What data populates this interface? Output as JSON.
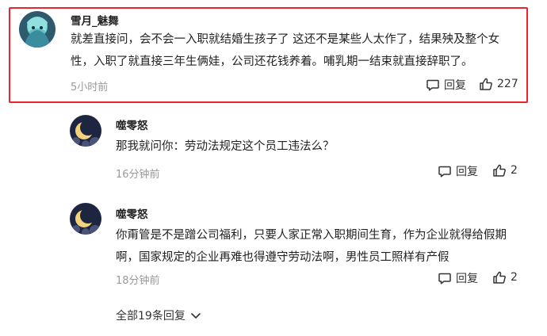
{
  "comments": [
    {
      "username": "雪月_魅舞",
      "text": "就差直接问，会不会一入职就结婚生孩子了 这还不是某些人太作了，结果殃及整个女性，入职了就直接三年生俩娃，公司还花钱养着。哺乳期一结束就直接辞职了。",
      "time": "5小时前",
      "reply_label": "回复",
      "like_count": "227"
    },
    {
      "username": "噬零怒",
      "text": "那我就问你：劳动法规定这个员工违法么？",
      "time": "16分钟前",
      "reply_label": "回复",
      "like_count": "2"
    },
    {
      "username": "噬零怒",
      "text": "你甭管是不是蹭公司福利，只要人家正常入职期间生育，作为企业就得给假期啊，国家规定的企业再难也得遵守劳动法啊，男性员工照样有产假",
      "time": "18分钟前",
      "reply_label": "回复",
      "like_count": "2"
    }
  ],
  "expand_replies_label": "全部19条回复",
  "icons": {
    "reply": "comment-bubble-icon",
    "like": "thumbs-up-icon",
    "expand": "chevron-down-icon"
  },
  "colors": {
    "highlight_border": "#e8262b",
    "muted_text": "#999999",
    "moon_avatar_bg": "#1d2541",
    "moon": "#f3d27a"
  }
}
